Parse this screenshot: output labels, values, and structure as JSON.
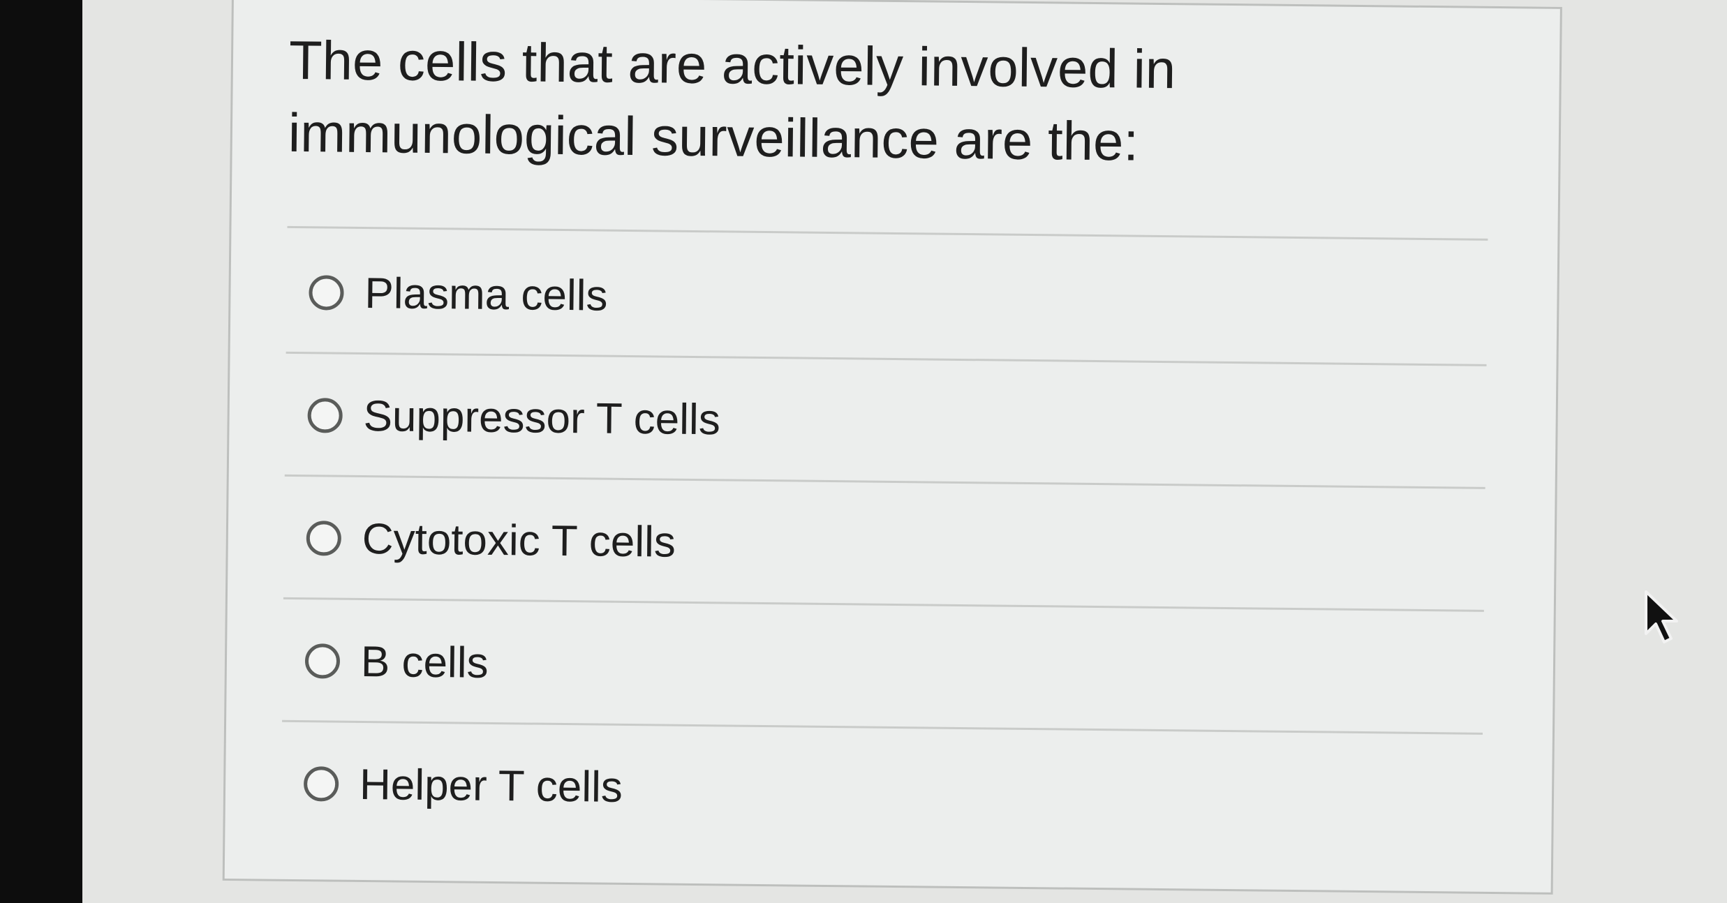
{
  "question": {
    "text": "The cells that are actively involved in immunological surveillance are the:"
  },
  "options": [
    {
      "label": "Plasma cells",
      "selected": false
    },
    {
      "label": "Suppressor T cells",
      "selected": false
    },
    {
      "label": "Cytotoxic T cells",
      "selected": false
    },
    {
      "label": "B cells",
      "selected": false
    },
    {
      "label": "Helper T cells",
      "selected": false
    }
  ],
  "icons": {
    "cursor": "mouse-pointer-icon",
    "radio": "radio-button"
  },
  "colors": {
    "card_background": "#eceeed",
    "text": "#1e1e1e",
    "radio_border": "#5a5c5a",
    "divider": "#c9cbc9"
  }
}
